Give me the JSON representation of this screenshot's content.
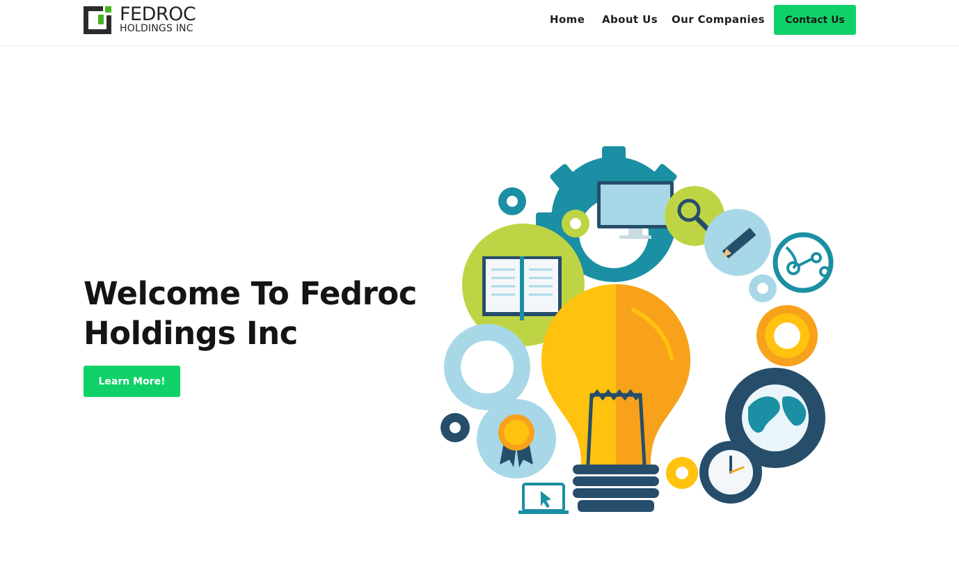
{
  "header": {
    "logo": {
      "line1": "FEDROC",
      "line2": "HOLDINGS INC",
      "icon": "logo-icon"
    },
    "nav": [
      {
        "label": "Home"
      },
      {
        "label": "About Us"
      },
      {
        "label": "Our Companies"
      }
    ],
    "contact_label": "Contact Us"
  },
  "hero": {
    "title_line1": "Welcome To Fedroc",
    "title_line2": "Holdings Inc",
    "cta_label": "Learn More!"
  },
  "illustration": {
    "icon": "lightbulb-gears-illustration"
  },
  "colors": {
    "accent": "#10d168",
    "logo_green": "#46b51e",
    "logo_dark": "#2b2b2b",
    "text": "#141414",
    "teal": "#1b8fa3",
    "yellow": "#ffc20e",
    "orange": "#f7a21a",
    "lime": "#bed444",
    "light_blue": "#a8d8e8",
    "navy": "#264e6a"
  }
}
